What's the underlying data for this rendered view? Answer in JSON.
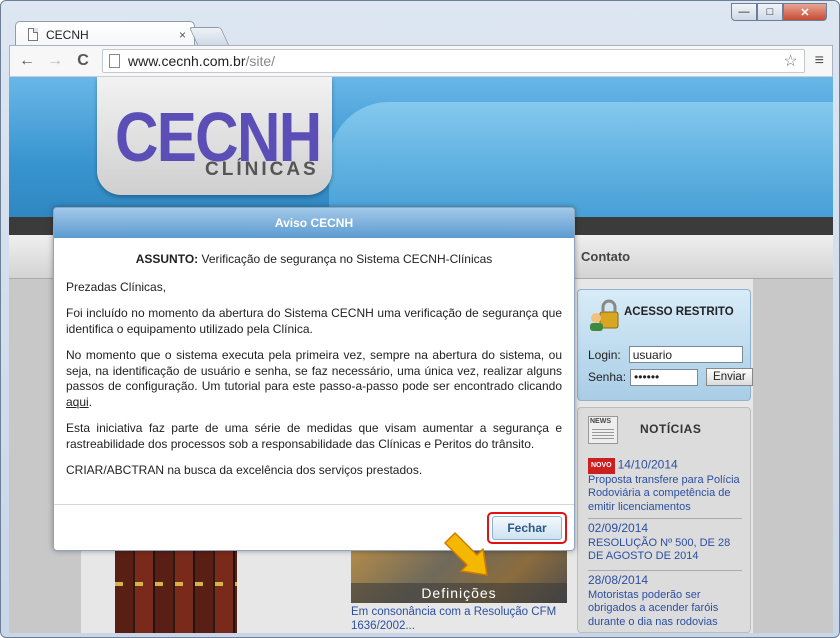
{
  "browser": {
    "tab_title": "CECNH",
    "tab_close": "×",
    "url_host": "www.cecnh.com.br",
    "url_path": "/site/",
    "back": "←",
    "forward": "→",
    "reload": "C",
    "star": "☆",
    "menu": "≡",
    "win_min": "—",
    "win_max": "□",
    "win_close": "✕"
  },
  "site": {
    "logo_main": "CECNH",
    "logo_sub": "CLÍNICAS",
    "menu_contato": "Contato",
    "login": {
      "title": "ACESSO RESTRITO",
      "user_label": "Login:",
      "user_value": "usuario",
      "pass_label": "Senha:",
      "pass_value": "••••••",
      "submit_label": "Enviar"
    },
    "news": {
      "title": "NOTÍCIAS",
      "badge": "NOVO",
      "items": [
        {
          "date": "14/10/2014",
          "text": "Proposta transfere para Polícia Rodoviária a competência de emitir licenciamentos"
        },
        {
          "date": "02/09/2014",
          "text": "RESOLUÇÃO Nº 500, DE 28 DE AGOSTO DE 2014"
        },
        {
          "date": "28/08/2014",
          "text": "Motoristas poderão ser obrigados a acender faróis durante o dia nas rodovias"
        }
      ]
    },
    "definicoes": {
      "caption": "Definições",
      "text": "Em consonância com a Resolução CFM 1636/2002..."
    }
  },
  "modal": {
    "title": "Aviso CECNH",
    "assunto_label": "ASSUNTO:",
    "assunto_text": " Verificação de segurança no Sistema CECNH-Clínicas",
    "greeting": "Prezadas Clínicas,",
    "p1": "Foi incluído no momento da abertura do Sistema CECNH uma verificação de segurança que identifica o equipamento utilizado pela Clínica.",
    "p2_before": "No momento que o sistema executa pela primeira vez, sempre na abertura do sistema, ou seja, na identificação de usuário e senha, se faz necessário, uma única vez, realizar alguns passos de configuração. Um tutorial para este passo-a-passo pode ser encontrado clicando ",
    "p2_link": "aqui",
    "p2_after": ".",
    "p3": "Esta iniciativa faz parte de uma série de medidas que visam aumentar a segurança e rastreabilidade dos processos sob a responsabilidade das Clínicas e Peritos do trânsito.",
    "p4": "CRIAR/ABCTRAN na busca da excelência dos serviços prestados.",
    "close_label": "Fechar"
  },
  "colors": {
    "highlight": "#e01212",
    "arrow": "#f5b800",
    "logo": "#5b4fb7",
    "link": "#2c4fa3"
  }
}
